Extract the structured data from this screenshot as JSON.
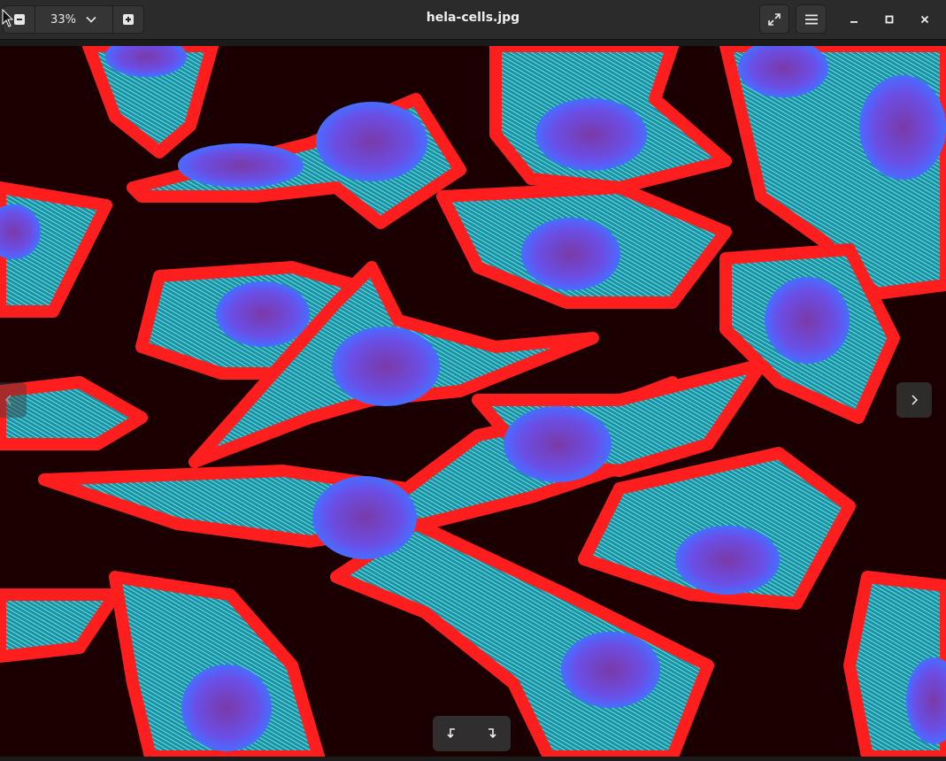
{
  "window": {
    "title": "hela-cells.jpg"
  },
  "toolbar": {
    "zoom_out_icon": "zoom-out-icon",
    "zoom_level": "33%",
    "zoom_in_icon": "zoom-in-icon",
    "fullscreen_icon": "fullscreen-icon",
    "menu_icon": "hamburger-menu-icon"
  },
  "window_controls": {
    "minimize_icon": "minimize-icon",
    "maximize_icon": "maximize-icon",
    "close_icon": "close-icon"
  },
  "image": {
    "description_colors": {
      "background": "#1a0000",
      "actin": "#ff1e1e",
      "microtubules": "#33c9d6",
      "nuclei": "#6a4fe6"
    }
  },
  "navigation": {
    "prev_icon": "chevron-left-icon",
    "next_icon": "chevron-right-icon",
    "rotate_left_icon": "rotate-left-icon",
    "rotate_right_icon": "rotate-right-icon"
  }
}
